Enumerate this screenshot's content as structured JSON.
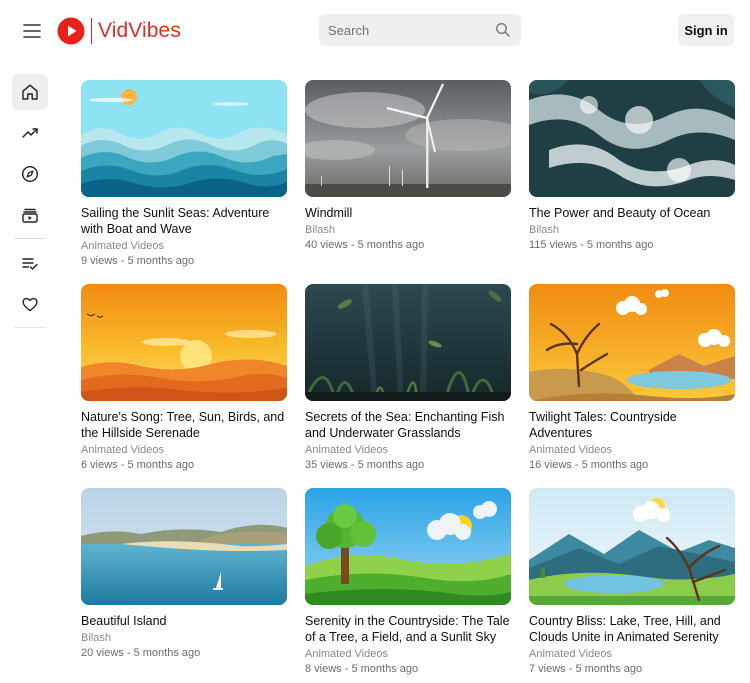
{
  "app": {
    "name": "VidVibes",
    "brand_color": "#d93025"
  },
  "header": {
    "menu_icon": "hamburger-menu-icon",
    "search_placeholder": "Search",
    "search_icon": "search-icon",
    "signin_label": "Sign in"
  },
  "sidebar": {
    "items": [
      {
        "name": "home",
        "icon": "home-icon",
        "active": true
      },
      {
        "name": "trending",
        "icon": "trending-icon",
        "active": false
      },
      {
        "name": "explore",
        "icon": "compass-icon",
        "active": false
      },
      {
        "name": "subscriptions",
        "icon": "subscriptions-icon",
        "active": false
      },
      {
        "name": "playlist",
        "icon": "playlist-check-icon",
        "active": false
      },
      {
        "name": "liked",
        "icon": "heart-icon",
        "active": false
      }
    ]
  },
  "videos": [
    {
      "title": "Sailing the Sunlit Seas: Adventure with Boat and Wave",
      "channel": "Animated Videos",
      "meta": "9 views - 5 months ago",
      "thumb": "waves-sunrise"
    },
    {
      "title": "Windmill",
      "channel": "Bilash",
      "meta": "40 views - 5 months ago",
      "thumb": "wind-turbine-storm"
    },
    {
      "title": "The Power and Beauty of Ocean",
      "channel": "Bilash",
      "meta": "115 views - 5 months ago",
      "thumb": "ocean-waves-aerial"
    },
    {
      "title": "Nature's Song: Tree, Sun, Birds, and the Hillside Serenade",
      "channel": "Animated Videos",
      "meta": "6 views - 5 months ago",
      "thumb": "orange-sunset-hills"
    },
    {
      "title": "Secrets of the Sea: Enchanting Fish and Underwater Grasslands",
      "channel": "Animated Videos",
      "meta": "35 views - 5 months ago",
      "thumb": "underwater-grass"
    },
    {
      "title": "Twilight Tales: Countryside Adventures",
      "channel": "Animated Videos",
      "meta": "16 views - 5 months ago",
      "thumb": "bare-tree-lake"
    },
    {
      "title": "Beautiful Island",
      "channel": "Bilash",
      "meta": "20 views - 5 months ago",
      "thumb": "island-beach"
    },
    {
      "title": "Serenity in the Countryside: The Tale of a Tree, a Field, and a Sunlit Sky",
      "channel": "Animated Videos",
      "meta": "8 views - 5 months ago",
      "thumb": "green-tree-field"
    },
    {
      "title": "Country Bliss: Lake, Tree, Hill, and Clouds Unite in Animated Serenity",
      "channel": "Animated Videos",
      "meta": "7 views - 5 months ago",
      "thumb": "lake-tree-hills"
    }
  ]
}
